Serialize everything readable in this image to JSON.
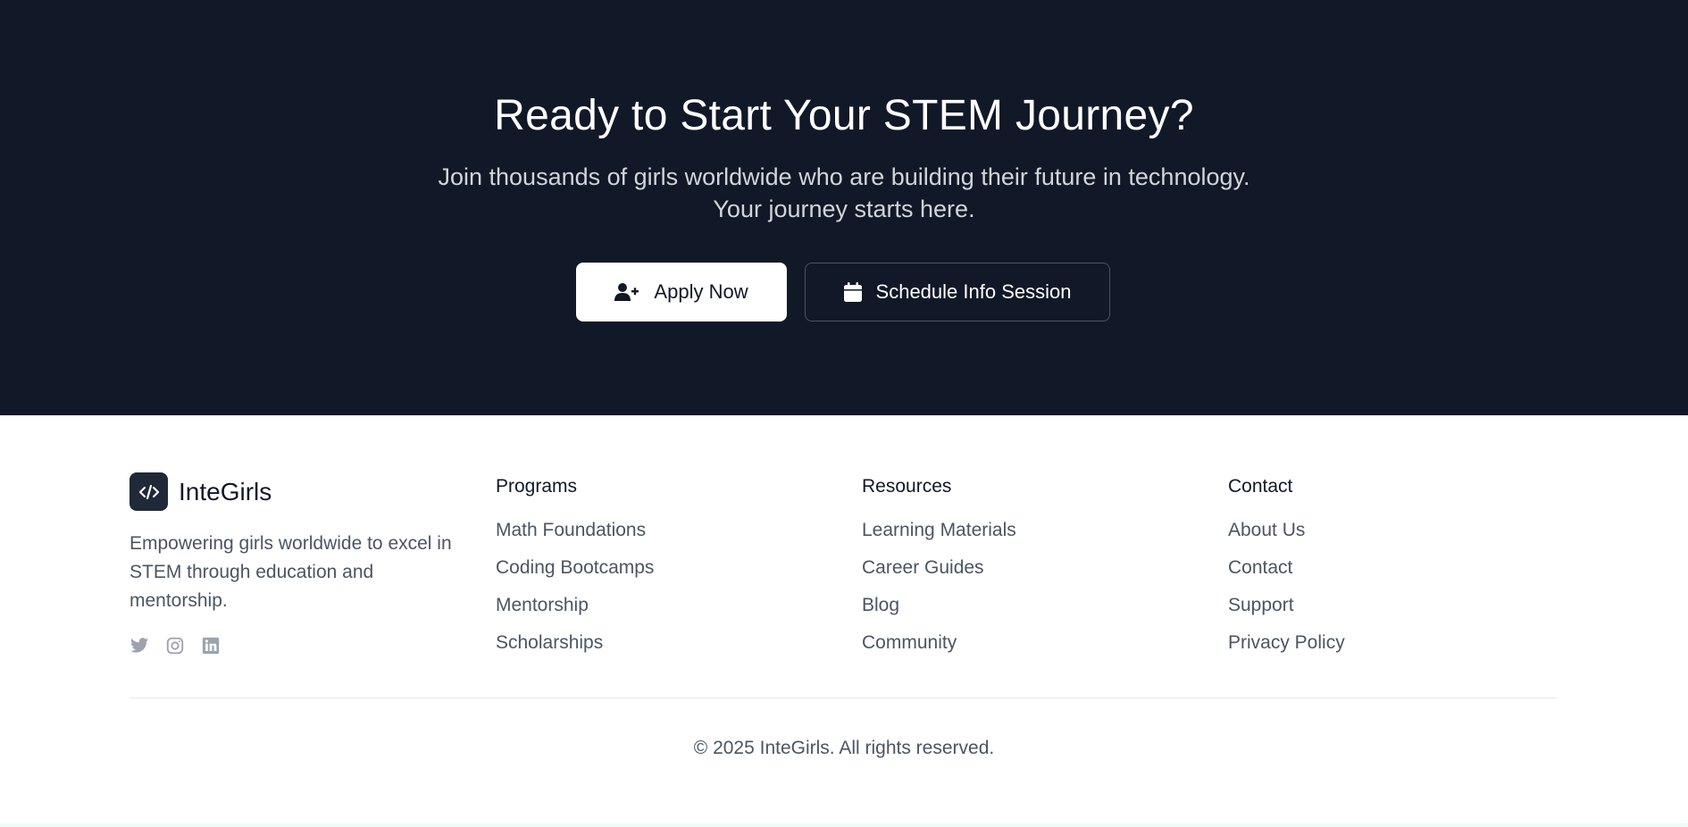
{
  "cta": {
    "title": "Ready to Start Your STEM Journey?",
    "subtitle_line1": "Join thousands of girls worldwide who are building their future in technology.",
    "subtitle_line2": "Your journey starts here.",
    "apply_label": "Apply Now",
    "apply_icon": "user-plus-icon",
    "info_label": "Schedule Info Session",
    "info_icon": "calendar-icon",
    "background": "#111827"
  },
  "footer": {
    "brand_name": "InteGirls",
    "brand_icon": "code-icon",
    "description": "Empowering girls worldwide to excel in STEM through education and mentorship.",
    "socials": [
      "twitter-icon",
      "instagram-icon",
      "linkedin-icon"
    ],
    "columns": [
      {
        "heading": "Programs",
        "links": [
          "Math Foundations",
          "Coding Bootcamps",
          "Mentorship",
          "Scholarships"
        ]
      },
      {
        "heading": "Resources",
        "links": [
          "Learning Materials",
          "Career Guides",
          "Blog",
          "Community"
        ]
      },
      {
        "heading": "Contact",
        "links": [
          "About Us",
          "Contact",
          "Support",
          "Privacy Policy"
        ]
      }
    ],
    "copyright": "© 2025 InteGirls. All rights reserved."
  }
}
